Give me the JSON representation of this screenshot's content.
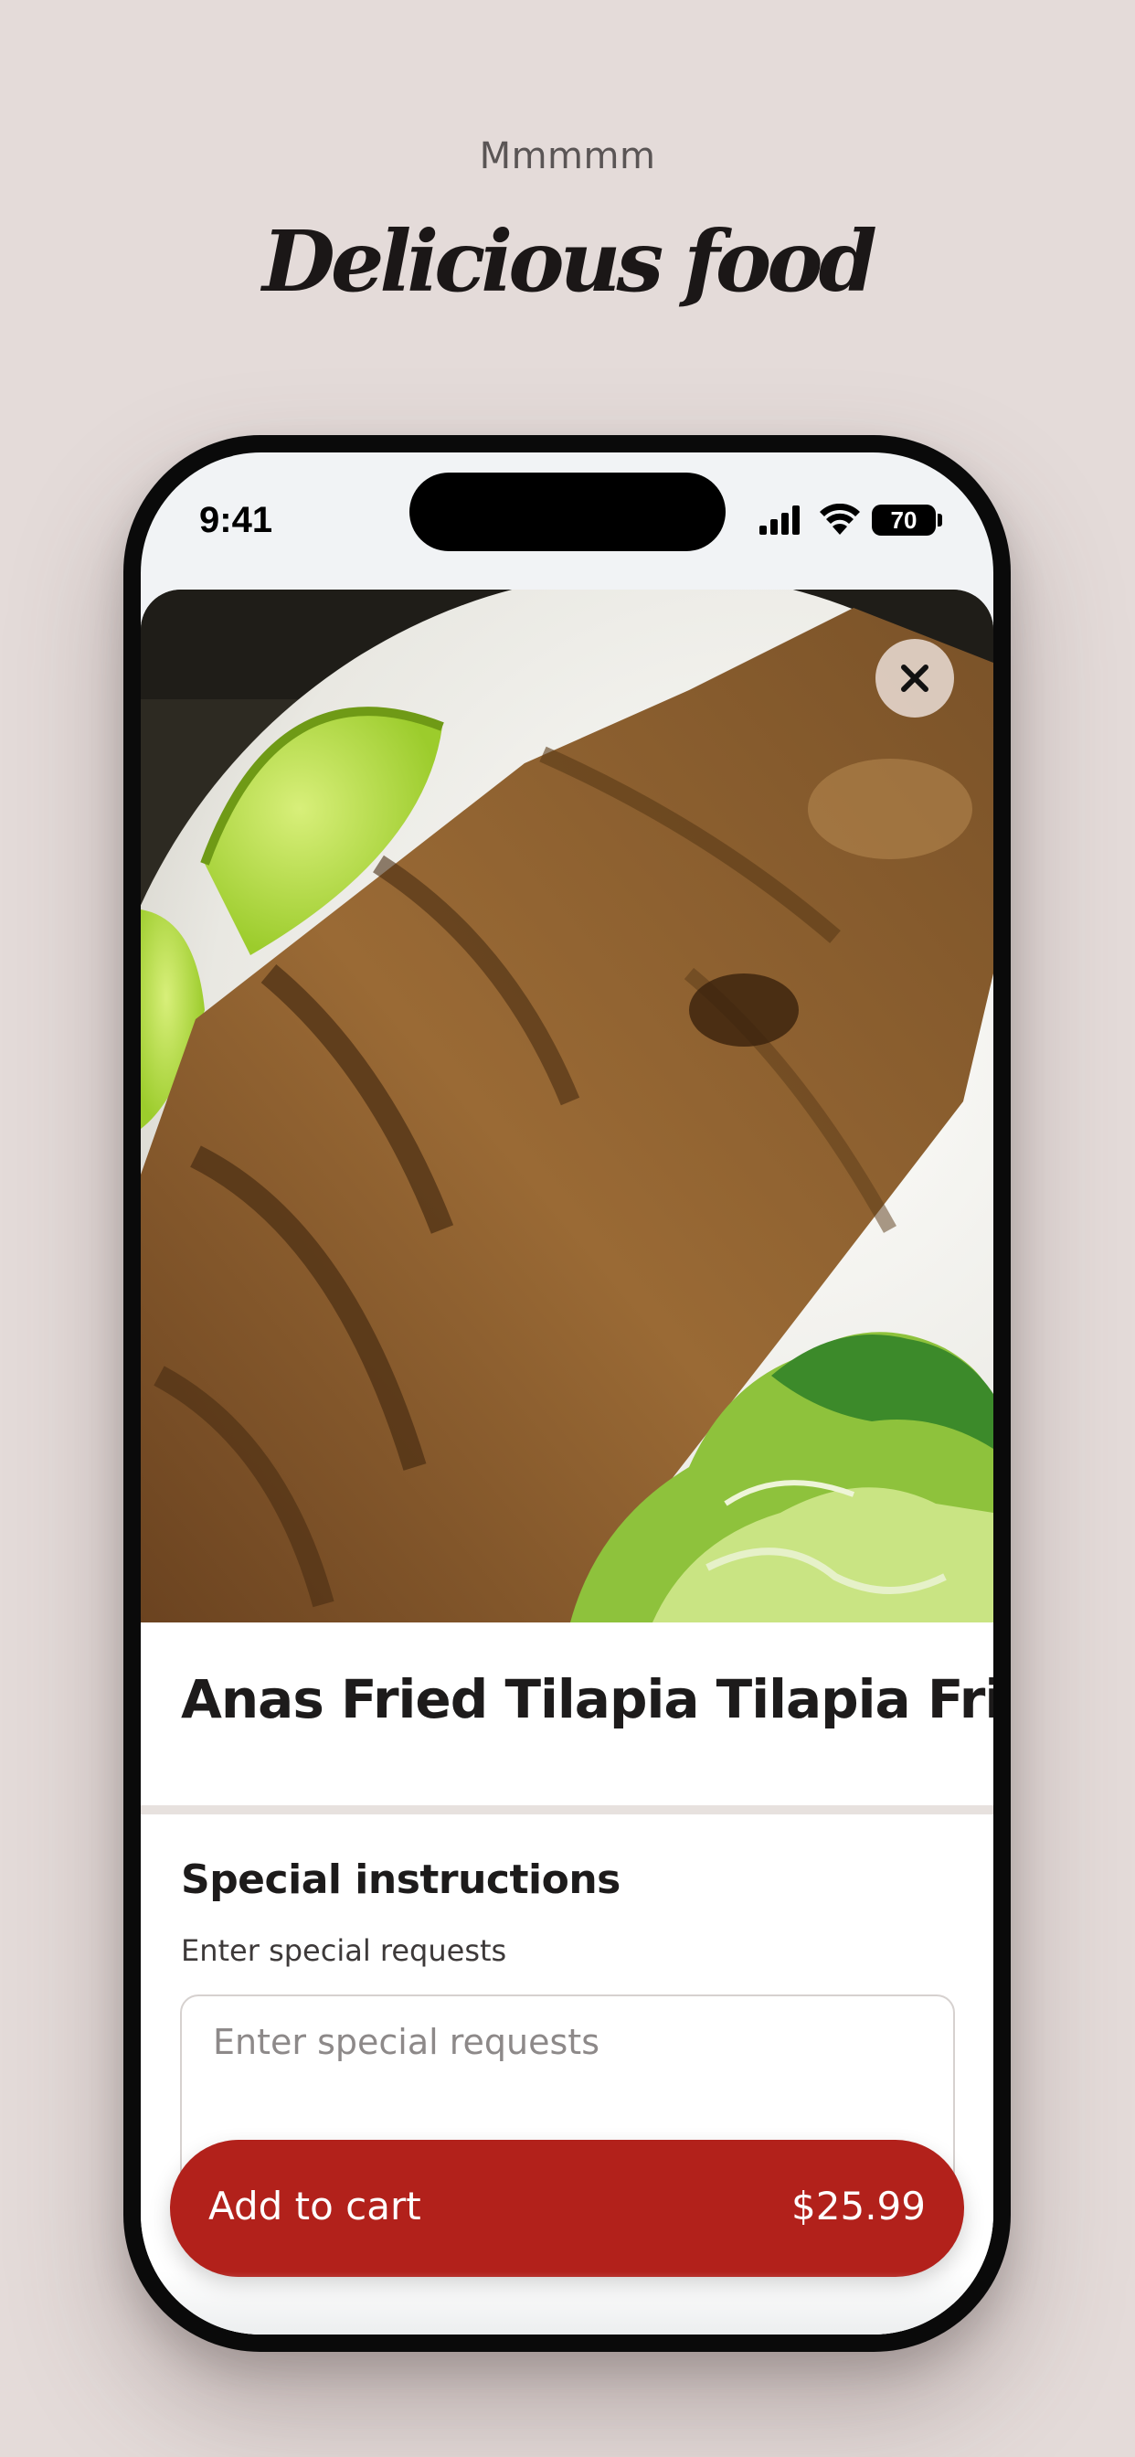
{
  "page": {
    "eyebrow": "Mmmmm",
    "headline": "Delicious food"
  },
  "status_bar": {
    "time": "9:41",
    "battery_level": "70",
    "icons": [
      "signal-icon",
      "wifi-icon",
      "battery-icon"
    ]
  },
  "item": {
    "image_description_icon": "food-photo",
    "close_icon": "close-icon",
    "title": "Anas Fried Tilapia Tilapia Frita"
  },
  "special_instructions": {
    "title": "Special instructions",
    "subtitle": "Enter special requests",
    "placeholder": "Enter special requests",
    "value": ""
  },
  "cart": {
    "label": "Add to cart",
    "price": "$25.99"
  },
  "colors": {
    "background": "#e4dbd9",
    "accent": "#b2211b",
    "text": "#1d1b1b"
  }
}
